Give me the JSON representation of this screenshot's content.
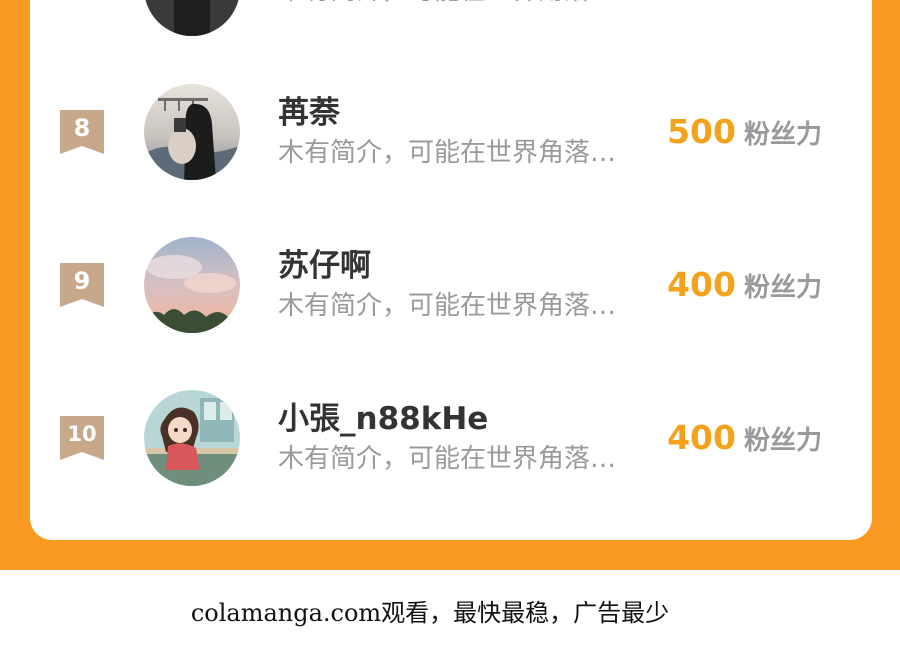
{
  "colors": {
    "accent_orange": "#fa9a23",
    "score_gold": "#f4a21c",
    "rank_badge": "#c8a88a",
    "text_dark": "#333333",
    "text_gray": "#9a9a9a"
  },
  "leaderboard": {
    "partial_row": {
      "bio": "木有简介，可能在世界角落…"
    },
    "rows": [
      {
        "rank": "8",
        "name": "苒萘",
        "bio": "木有简介，可能在世界角落…",
        "score": "500",
        "unit": "粉丝力",
        "avatar_icon": "portrait-photo-avatar"
      },
      {
        "rank": "9",
        "name": "苏仔啊",
        "bio": "木有简介，可能在世界角落…",
        "score": "400",
        "unit": "粉丝力",
        "avatar_icon": "sky-photo-avatar"
      },
      {
        "rank": "10",
        "name": "小張_n88kHe",
        "bio": "木有简介，可能在世界角落…",
        "score": "400",
        "unit": "粉丝力",
        "avatar_icon": "anime-girl-avatar"
      }
    ]
  },
  "footer": {
    "watermark": "colamanga.com观看，最快最稳，广告最少"
  }
}
